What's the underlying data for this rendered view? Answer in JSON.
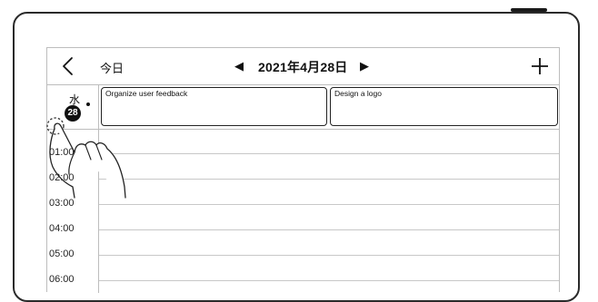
{
  "header": {
    "today_label": "今日",
    "prev_label": "◀",
    "date_title": "2021年4月28日",
    "next_label": "▶"
  },
  "allday": {
    "weekday": "水",
    "day_number": "28",
    "events": [
      {
        "title": "Organize user feedback"
      },
      {
        "title": "Design a logo"
      }
    ]
  },
  "hours": [
    "01:00",
    "02:00",
    "03:00",
    "04:00",
    "05:00",
    "06:00"
  ],
  "icons": {
    "back": "chevron-left-icon",
    "add": "plus-icon",
    "hand": "tap-hand-icon"
  }
}
